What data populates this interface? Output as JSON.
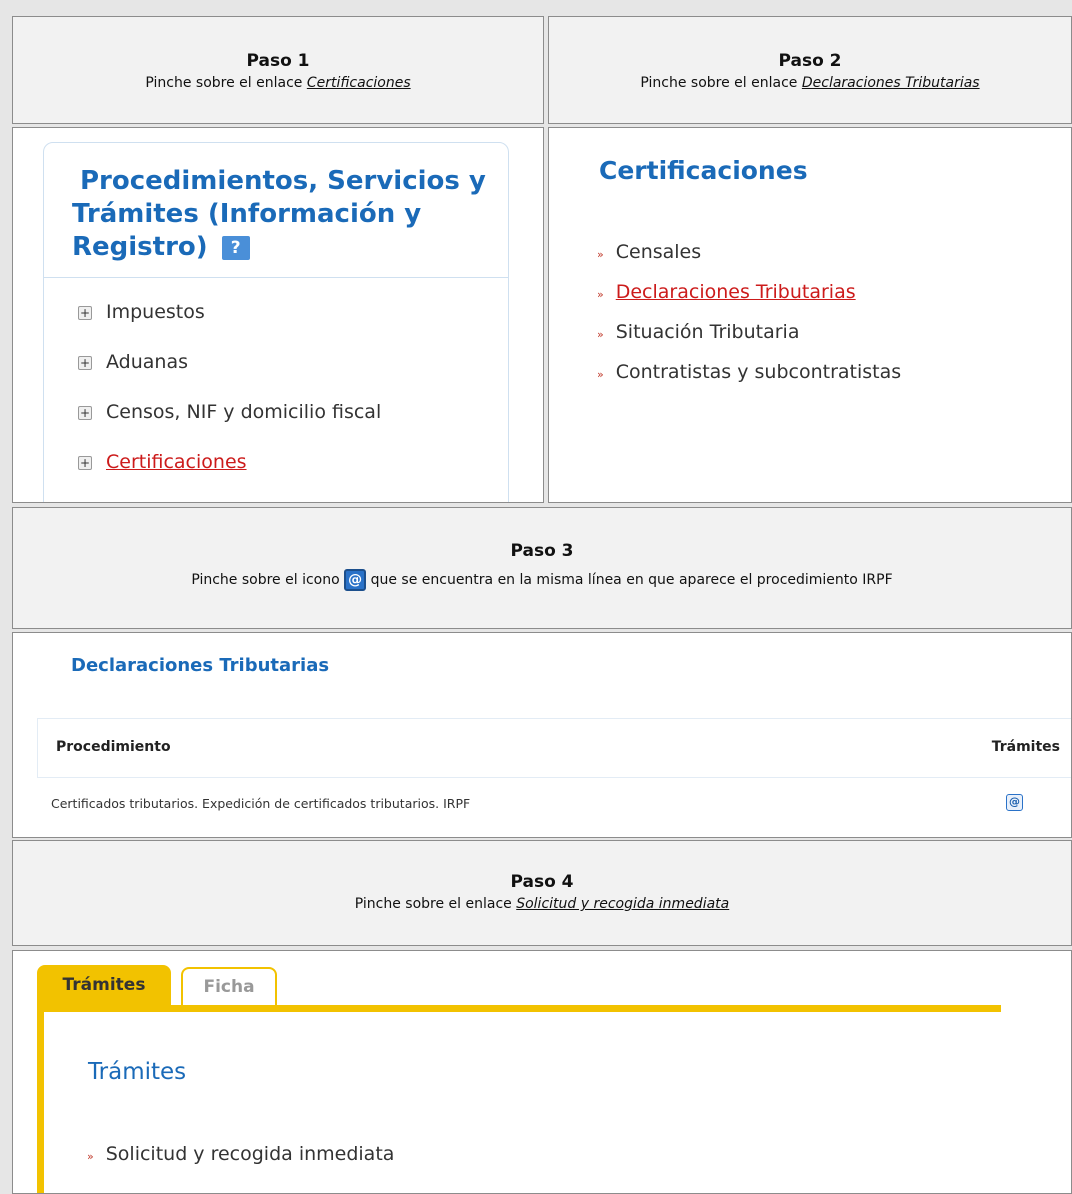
{
  "step1": {
    "title": "Paso 1",
    "desc_prefix": "Pinche sobre el enlace ",
    "desc_link": "Certificaciones"
  },
  "step2": {
    "title": "Paso 2",
    "desc_prefix": "Pinche sobre el enlace ",
    "desc_link": "Declaraciones Tributarias"
  },
  "step3": {
    "title": "Paso 3",
    "desc_prefix": "Pinche sobre el icono ",
    "desc_suffix": " que se encuentra en la misma línea en que aparece el procedimiento IRPF"
  },
  "step4": {
    "title": "Paso 4",
    "desc_prefix": "Pinche sobre el enlace ",
    "desc_link": "Solicitud y recogida inmediata"
  },
  "panel1": {
    "heading_line1": "Procedimientos, Servicios y",
    "heading_line2": "Trámites (Información y",
    "heading_line3": "Registro)",
    "help_icon": "?",
    "items": [
      "Impuestos",
      "Aduanas",
      "Censos, NIF y domicilio fiscal",
      "Certificaciones"
    ]
  },
  "panel2": {
    "heading": "Certificaciones",
    "items": [
      "Censales",
      "Declaraciones Tributarias",
      "Situación Tributaria",
      "Contratistas y subcontratistas"
    ]
  },
  "panel3": {
    "heading": "Declaraciones Tributarias",
    "col_procedimiento": "Procedimiento",
    "col_tramites": "Trámites",
    "row_text": "Certificados tributarios. Expedición de certificados tributarios. IRPF",
    "at_icon": "@"
  },
  "panel4": {
    "tab_active": "Trámites",
    "tab_inactive": "Ficha",
    "heading": "Trámites",
    "item": "Solicitud y recogida inmediata"
  },
  "colors": {
    "blue_heading": "#1a6ab8",
    "red_link": "#cc1b1b",
    "yellow_tab": "#f2c200"
  }
}
